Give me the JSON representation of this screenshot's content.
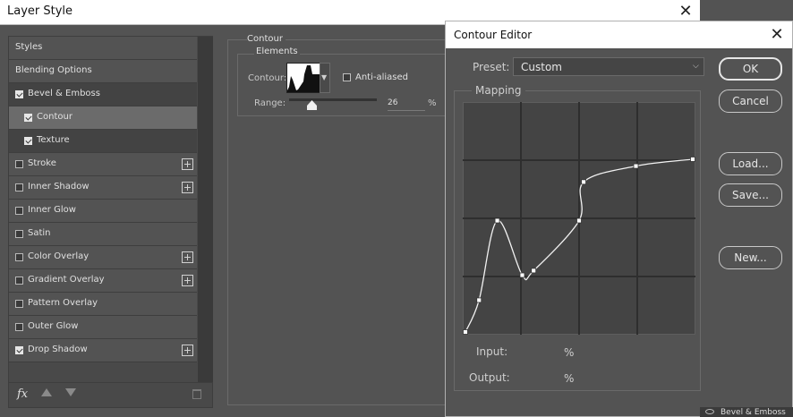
{
  "window": {
    "title": "Layer Style",
    "close_glyph": "✕"
  },
  "styles_list": {
    "header_styles": "Styles",
    "header_blending": "Blending Options",
    "items": [
      {
        "label": "Bevel & Emboss",
        "checked": true
      },
      {
        "label": "Contour",
        "checked": true
      },
      {
        "label": "Texture",
        "checked": true
      },
      {
        "label": "Stroke",
        "checked": false
      },
      {
        "label": "Inner Shadow",
        "checked": false
      },
      {
        "label": "Inner Glow",
        "checked": false
      },
      {
        "label": "Satin",
        "checked": false
      },
      {
        "label": "Color Overlay",
        "checked": false
      },
      {
        "label": "Gradient Overlay",
        "checked": false
      },
      {
        "label": "Pattern Overlay",
        "checked": false
      },
      {
        "label": "Outer Glow",
        "checked": false
      },
      {
        "label": "Drop Shadow",
        "checked": true
      }
    ],
    "fx_label": "fx"
  },
  "contour_panel": {
    "group_title": "Contour",
    "elements_title": "Elements",
    "contour_label": "Contour:",
    "anti_aliased_label": "Anti-aliased",
    "anti_aliased": false,
    "range_label": "Range:",
    "range_value": "26",
    "range_unit": "%",
    "range_fraction": 0.26
  },
  "contour_editor": {
    "title": "Contour Editor",
    "close_glyph": "✕",
    "preset_label": "Preset:",
    "preset_value": "Custom",
    "mapping_label": "Mapping",
    "input_label": "Input:",
    "input_unit": "%",
    "output_label": "Output:",
    "output_unit": "%",
    "buttons": {
      "ok": "OK",
      "cancel": "Cancel",
      "load": "Load...",
      "save": "Save...",
      "new": "New..."
    },
    "curve_points": [
      {
        "input": 0,
        "output": 0
      },
      {
        "input": 6,
        "output": 14
      },
      {
        "input": 14,
        "output": 49
      },
      {
        "input": 25,
        "output": 25
      },
      {
        "input": 30,
        "output": 27
      },
      {
        "input": 50,
        "output": 49
      },
      {
        "input": 52,
        "output": 66
      },
      {
        "input": 75,
        "output": 73
      },
      {
        "input": 100,
        "output": 76
      }
    ]
  },
  "background_panel": {
    "label": "Bevel & Emboss"
  }
}
